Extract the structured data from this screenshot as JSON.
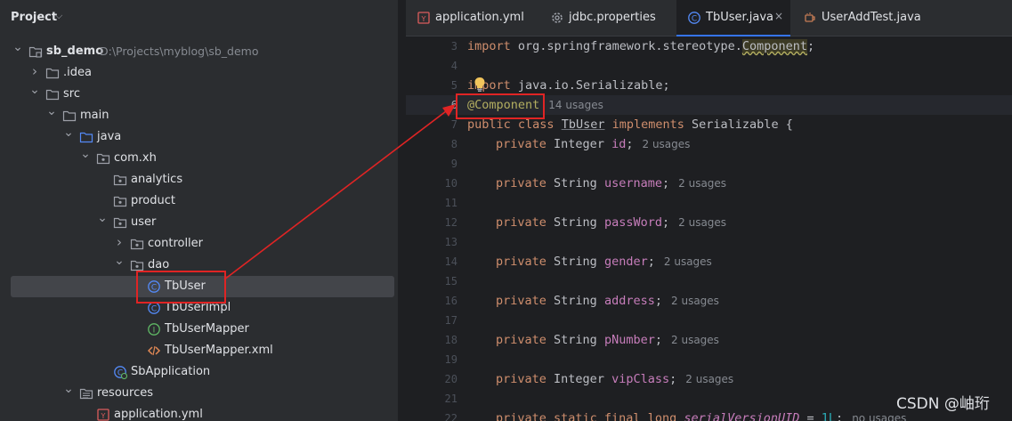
{
  "project_pane": {
    "title": "Project",
    "tree": [
      {
        "label": "sb_demo",
        "path": "D:\\Projects\\myblog\\sb_demo",
        "icon": "module-folder-icon",
        "chevron": "down",
        "indent": 0
      },
      {
        "label": ".idea",
        "icon": "folder-icon",
        "chevron": "right",
        "indent": 1
      },
      {
        "label": "src",
        "icon": "folder-icon",
        "chevron": "down",
        "indent": 1
      },
      {
        "label": "main",
        "icon": "folder-icon",
        "chevron": "down",
        "indent": 2
      },
      {
        "label": "java",
        "icon": "source-folder-icon",
        "chevron": "down",
        "indent": 3
      },
      {
        "label": "com.xh",
        "icon": "package-icon",
        "chevron": "down",
        "indent": 4
      },
      {
        "label": "analytics",
        "icon": "package-icon",
        "chevron": "none",
        "indent": 5
      },
      {
        "label": "product",
        "icon": "package-icon",
        "chevron": "none",
        "indent": 5
      },
      {
        "label": "user",
        "icon": "package-icon",
        "chevron": "down",
        "indent": 5
      },
      {
        "label": "controller",
        "icon": "package-icon",
        "chevron": "right",
        "indent": 6
      },
      {
        "label": "dao",
        "icon": "package-icon",
        "chevron": "down",
        "indent": 6
      },
      {
        "label": "TbUser",
        "icon": "class-icon",
        "chevron": "none",
        "indent": 7,
        "selected": true
      },
      {
        "label": "TbUserImpl",
        "icon": "class-icon",
        "chevron": "none",
        "indent": 7
      },
      {
        "label": "TbUserMapper",
        "icon": "interface-icon",
        "chevron": "none",
        "indent": 7
      },
      {
        "label": "TbUserMapper.xml",
        "icon": "xml-file-icon",
        "chevron": "none",
        "indent": 7
      },
      {
        "label": "SbApplication",
        "icon": "spring-class-icon",
        "chevron": "none",
        "indent": 5
      },
      {
        "label": "resources",
        "icon": "resources-folder-icon",
        "chevron": "down",
        "indent": 3
      },
      {
        "label": "application.yml",
        "icon": "yaml-file-icon",
        "chevron": "none",
        "indent": 4
      }
    ]
  },
  "editor": {
    "tabs": [
      {
        "label": "application.yml",
        "icon": "yaml-file-icon",
        "active": false
      },
      {
        "label": "jdbc.properties",
        "icon": "gear-icon",
        "active": false
      },
      {
        "label": "TbUser.java",
        "icon": "class-icon",
        "active": true,
        "close": "×"
      },
      {
        "label": "UserAddTest.java",
        "icon": "test-class-icon",
        "active": false
      }
    ],
    "line_numbers": [
      "3",
      "4",
      "5",
      "6",
      "7",
      "8",
      "9",
      "10",
      "11",
      "12",
      "13",
      "14",
      "15",
      "16",
      "17",
      "18",
      "19",
      "20",
      "21",
      "22"
    ],
    "current_line": "6",
    "code": {
      "l3_kw": "import",
      "l3_pkg": " org.springframework.stereotype.",
      "l3_cls": "Component",
      "l3_end": ";",
      "l5_kw": "import",
      "l5_rest": " java.io.Serializable;",
      "l6_ann": "@Component",
      "l6_hint": "14 usages",
      "l7_kw1": "public",
      "l7_kw2": "class",
      "l7_name": "TbUser",
      "l7_kw3": "implements",
      "l7_rest": " Serializable {",
      "fields": [
        {
          "type": "Integer",
          "name": "id",
          "hint": "2 usages"
        },
        {
          "type": "String",
          "name": "username",
          "hint": "2 usages"
        },
        {
          "type": "String",
          "name": "passWord",
          "hint": "2 usages"
        },
        {
          "type": "String",
          "name": "gender",
          "hint": "2 usages"
        },
        {
          "type": "String",
          "name": "address",
          "hint": "2 usages"
        },
        {
          "type": "String",
          "name": "pNumber",
          "hint": "2 usages"
        },
        {
          "type": "Integer",
          "name": "vipClass",
          "hint": "2 usages"
        }
      ],
      "private_kw": "private",
      "l22_kws": "private static final",
      "l22_type": " long ",
      "l22_name": "serialVersionUID",
      "l22_eq": " = ",
      "l22_val": "1L",
      "l22_end": ";",
      "l22_hint": "no usages"
    }
  },
  "watermark": "CSDN @岫珩",
  "colors": {
    "highlight_box": "#e02424",
    "selection": "#43454a",
    "accent": "#3574f0"
  }
}
